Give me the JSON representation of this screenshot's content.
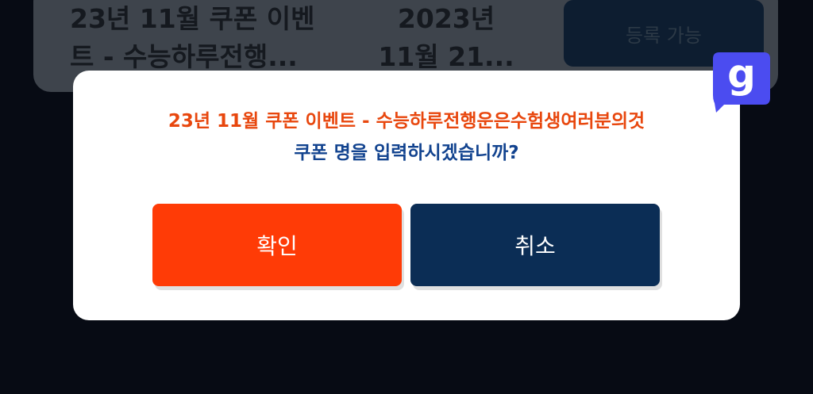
{
  "background_card": {
    "title": "23년 11월 쿠폰 이벤\n트 - 수능하루전행...",
    "date": "2023년\n11월 21...",
    "register_label": "등록 가능"
  },
  "dialog": {
    "message_line1": "23년 11월 쿠폰 이벤트 - 수능하루전행운은수험생여러분의것",
    "message_line2": "쿠폰 명을 입력하시겠습니까?",
    "confirm_label": "확인",
    "cancel_label": "취소"
  },
  "badge": {
    "glyph": "g",
    "icon": "app-badge-icon"
  },
  "colors": {
    "confirm": "#ff3b06",
    "cancel": "#0b2d55",
    "message_highlight": "#e8470e",
    "message_question": "#12438f",
    "badge": "#4b4cf0"
  }
}
